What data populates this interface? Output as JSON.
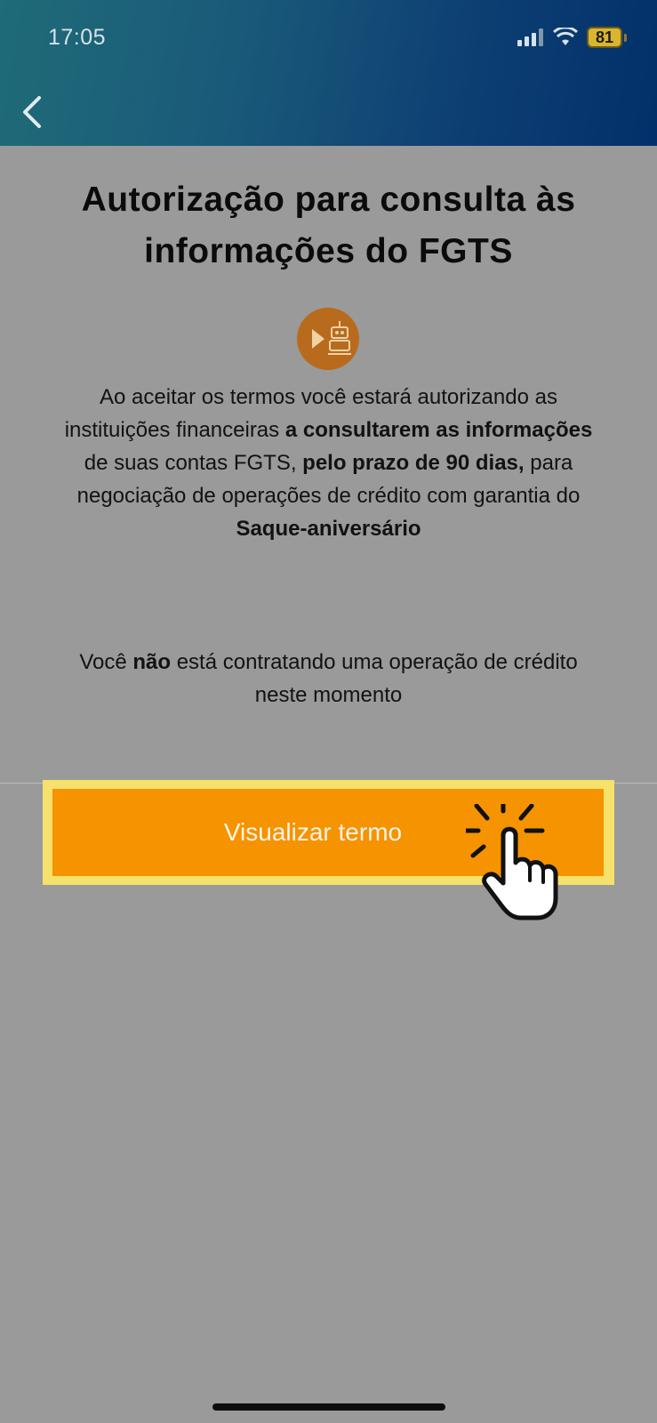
{
  "status_bar": {
    "time": "17:05",
    "battery": "81"
  },
  "nav": {
    "back_icon": "chevron-left-icon"
  },
  "page": {
    "title_line1": "Autorização para consulta às",
    "title_line2": "informações do FGTS",
    "feature_icon": "video-robot-icon",
    "body": {
      "p1": "Ao aceitar os termos você estará autorizando as instituições financeiras ",
      "b1": "a consultarem as informações",
      "p2": " de suas contas FGTS, ",
      "b2": "pelo prazo de 90 dias,",
      "p3": " para negociação de operações de crédito com garantia do ",
      "b3": "Saque-aniversário"
    },
    "note": {
      "p1": "Você ",
      "b1": "não",
      "p2": " está contratando uma operação de crédito neste momento"
    },
    "cta_label": "Visualizar termo",
    "tap_icon": "pointing-hand-tap-icon"
  },
  "colors": {
    "header_start": "#1f6b78",
    "header_end": "#02306a",
    "background": "#9a9a9a",
    "cta": "#f59300",
    "cta_highlight": "#f5e16b"
  }
}
